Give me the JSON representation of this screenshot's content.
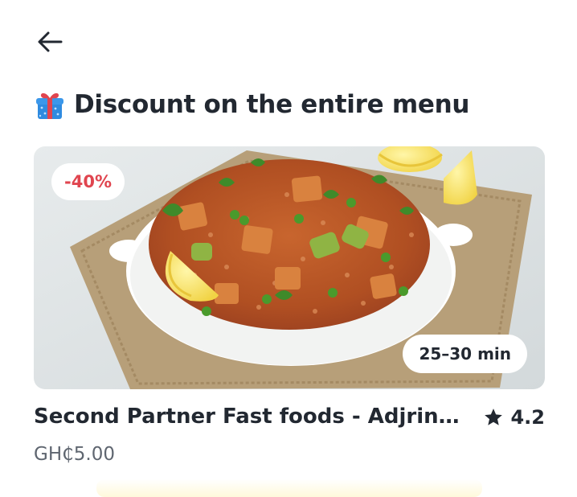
{
  "header": {
    "back_icon": "arrow-left-icon"
  },
  "section": {
    "icon": "gift-icon",
    "title": "Discount on the entire menu"
  },
  "restaurant_card": {
    "discount_badge": "-40%",
    "delivery_time": "25–30 min",
    "name": "Second Partner Fast foods - Adjringanor",
    "rating_icon": "star-icon",
    "rating": "4.2",
    "price": "GH₵5.00",
    "image": "fried-rice-dish-image"
  },
  "colors": {
    "text_primary": "#222831",
    "text_secondary": "#5f6670",
    "discount_red": "#e0454f",
    "gift_blue": "#2f8be0",
    "gift_red": "#e0454f"
  }
}
